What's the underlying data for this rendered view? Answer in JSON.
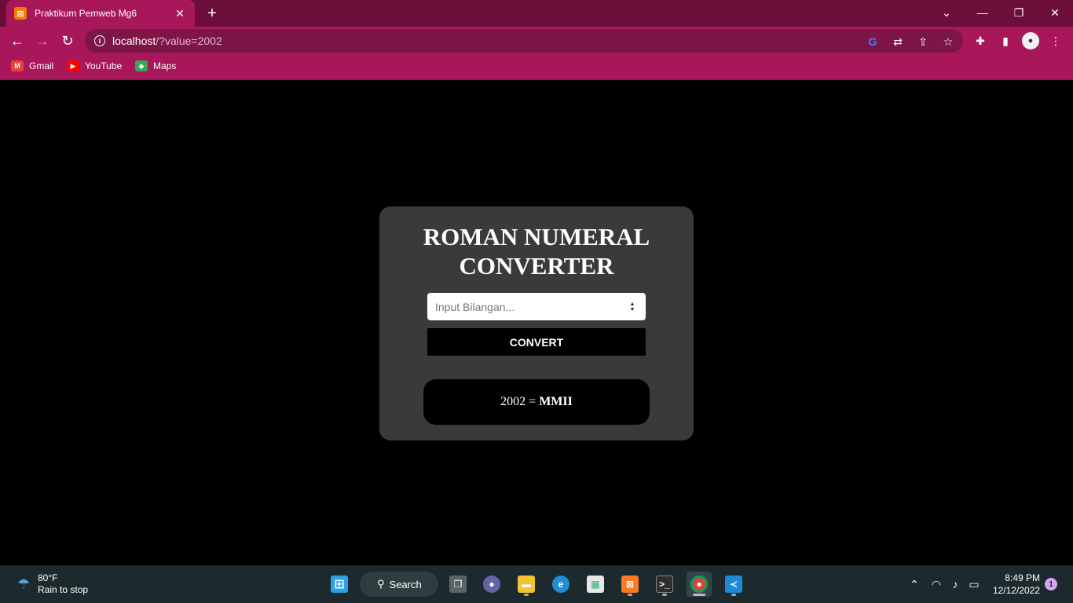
{
  "browser": {
    "tab": {
      "title": "Praktikum Pemweb Mg6",
      "favicon": "xampp-icon"
    },
    "address": {
      "host": "localhost",
      "query": "/?value=2002"
    },
    "bookmarks": [
      {
        "label": "Gmail",
        "icon": "gmail-icon",
        "color": "#ea4335"
      },
      {
        "label": "YouTube",
        "icon": "youtube-icon",
        "color": "#ff0000"
      },
      {
        "label": "Maps",
        "icon": "maps-icon",
        "color": "#34a853"
      }
    ],
    "theme_color": "#a8175a"
  },
  "page": {
    "title_line1": "ROMAN NUMERAL",
    "title_line2": "CONVERTER",
    "input_placeholder": "Input Bilangan...",
    "convert_label": "CONVERT",
    "result": {
      "number": "2002",
      "equals": "=",
      "roman": "MMII"
    }
  },
  "taskbar": {
    "weather": {
      "temp": "80°F",
      "condition": "Rain to stop"
    },
    "search_label": "Search",
    "clock": {
      "time": "8:49 PM",
      "date": "12/12/2022"
    },
    "notification_count": "1"
  }
}
